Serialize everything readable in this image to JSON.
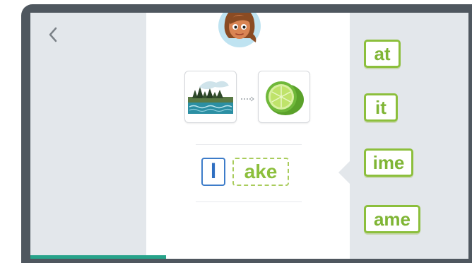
{
  "word": {
    "first_letter": "l",
    "blank_ending": "ake"
  },
  "choices": [
    {
      "label": "at"
    },
    {
      "label": "it"
    },
    {
      "label": "ime"
    },
    {
      "label": "ame"
    }
  ],
  "pictures": [
    {
      "icon": "lake-image"
    },
    {
      "icon": "lime-image"
    }
  ],
  "progress": {
    "fraction": 0.31
  },
  "colors": {
    "accent_green": "#8cbf3c",
    "letter_blue": "#3d7cc9",
    "progress_teal": "#27a38a",
    "panel_gray": "#e3e7eb",
    "bezel": "#4f575f"
  },
  "icons": {
    "back": "chevron-left-icon",
    "avatar": "avatar-girl-icon"
  }
}
